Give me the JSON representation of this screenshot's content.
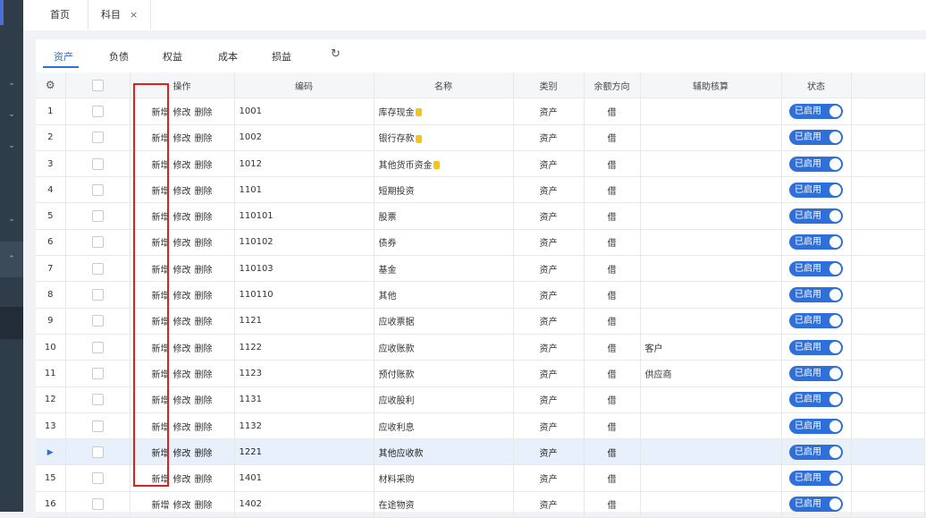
{
  "tabs": {
    "home": "首页",
    "subject": "科目",
    "close": "×"
  },
  "subtabs": [
    "资产",
    "负债",
    "权益",
    "成本",
    "损益"
  ],
  "refresh_icon": "refresh-icon",
  "columns": [
    "操作",
    "编码",
    "名称",
    "类别",
    "余额方向",
    "辅助核算",
    "状态"
  ],
  "ops": {
    "add": "新增",
    "edit": "修改",
    "delete": "删除"
  },
  "status_label": "已启用",
  "accent_color": "#2f6fd9",
  "highlight_color": "#e02020",
  "rows": [
    {
      "no": "1",
      "code": "1001",
      "name": "库存现金",
      "coin": true,
      "indent": false,
      "type": "资产",
      "dir": "借",
      "aux": ""
    },
    {
      "no": "2",
      "code": "1002",
      "name": "银行存款",
      "coin": true,
      "indent": false,
      "type": "资产",
      "dir": "借",
      "aux": ""
    },
    {
      "no": "3",
      "code": "1012",
      "name": "其他货币资金",
      "coin": true,
      "indent": false,
      "type": "资产",
      "dir": "借",
      "aux": ""
    },
    {
      "no": "4",
      "code": "1101",
      "name": "短期投资",
      "coin": false,
      "indent": false,
      "type": "资产",
      "dir": "借",
      "aux": ""
    },
    {
      "no": "5",
      "code": "110101",
      "name": "股票",
      "coin": false,
      "indent": true,
      "type": "资产",
      "dir": "借",
      "aux": ""
    },
    {
      "no": "6",
      "code": "110102",
      "name": "债券",
      "coin": false,
      "indent": true,
      "type": "资产",
      "dir": "借",
      "aux": ""
    },
    {
      "no": "7",
      "code": "110103",
      "name": "基金",
      "coin": false,
      "indent": true,
      "type": "资产",
      "dir": "借",
      "aux": ""
    },
    {
      "no": "8",
      "code": "110110",
      "name": "其他",
      "coin": false,
      "indent": true,
      "type": "资产",
      "dir": "借",
      "aux": ""
    },
    {
      "no": "9",
      "code": "1121",
      "name": "应收票据",
      "coin": false,
      "indent": false,
      "type": "资产",
      "dir": "借",
      "aux": ""
    },
    {
      "no": "10",
      "code": "1122",
      "name": "应收账款",
      "coin": false,
      "indent": false,
      "type": "资产",
      "dir": "借",
      "aux": "客户"
    },
    {
      "no": "11",
      "code": "1123",
      "name": "预付账款",
      "coin": false,
      "indent": false,
      "type": "资产",
      "dir": "借",
      "aux": "供应商"
    },
    {
      "no": "12",
      "code": "1131",
      "name": "应收股利",
      "coin": false,
      "indent": false,
      "type": "资产",
      "dir": "借",
      "aux": ""
    },
    {
      "no": "13",
      "code": "1132",
      "name": "应收利息",
      "coin": false,
      "indent": false,
      "type": "资产",
      "dir": "借",
      "aux": ""
    },
    {
      "no": "",
      "code": "1221",
      "name": "其他应收款",
      "coin": false,
      "indent": false,
      "type": "资产",
      "dir": "借",
      "aux": "",
      "selected": true
    },
    {
      "no": "15",
      "code": "1401",
      "name": "材料采购",
      "coin": false,
      "indent": false,
      "type": "资产",
      "dir": "借",
      "aux": ""
    },
    {
      "no": "16",
      "code": "1402",
      "name": "在途物资",
      "coin": false,
      "indent": false,
      "type": "资产",
      "dir": "借",
      "aux": ""
    }
  ]
}
